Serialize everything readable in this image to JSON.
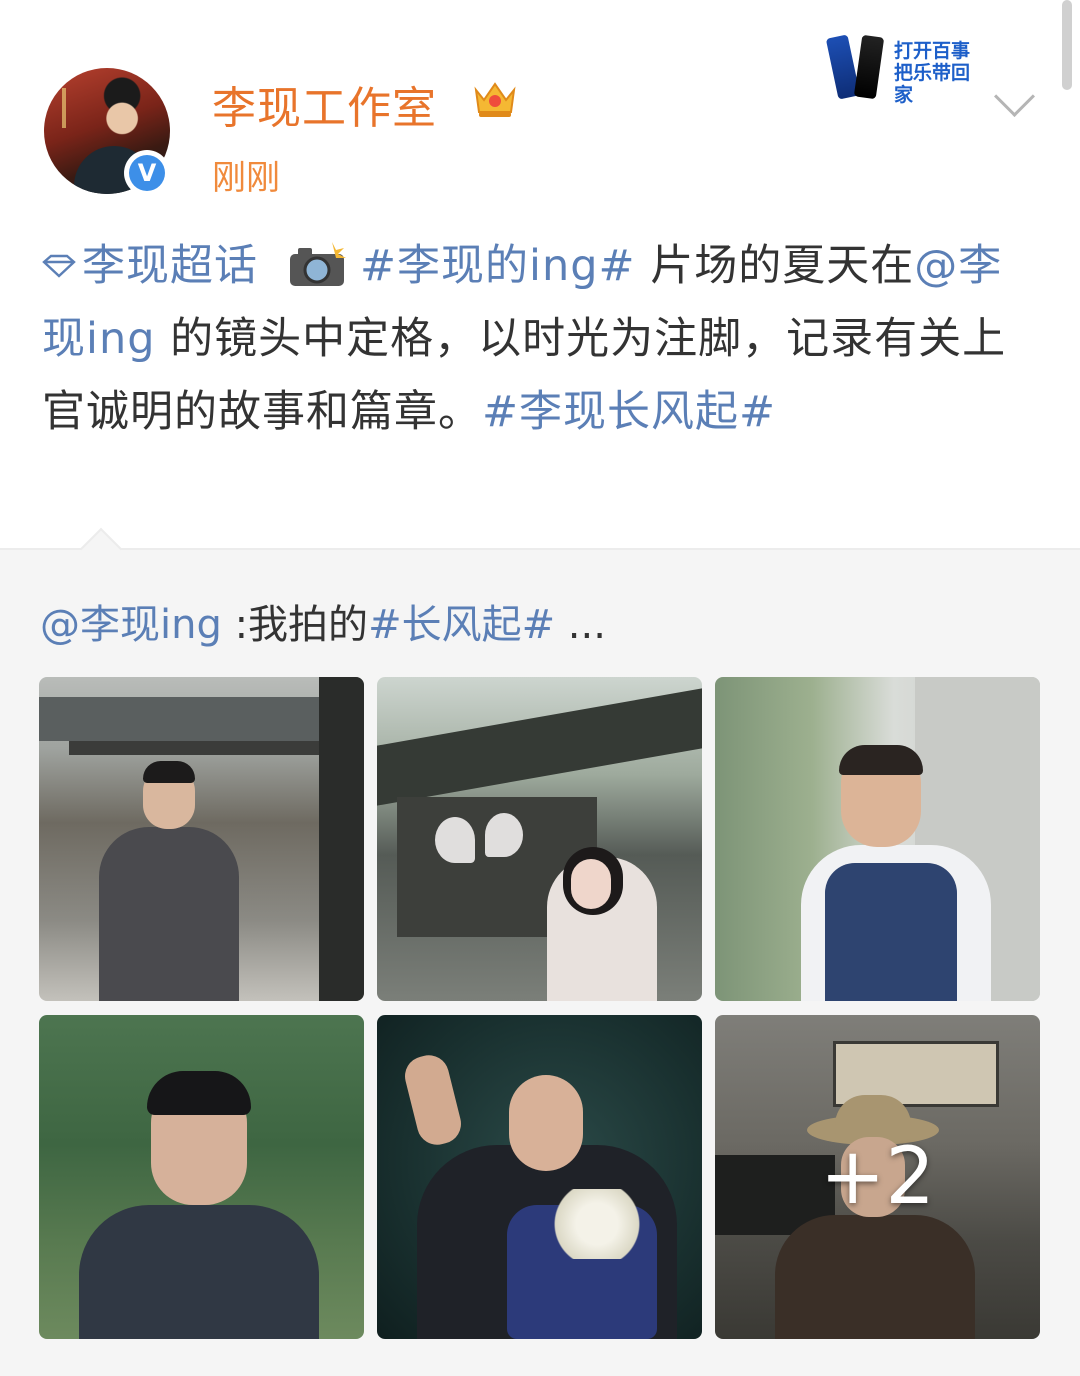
{
  "post": {
    "username": "李现工作室",
    "timestamp": "刚刚",
    "ad_text_line1": "打开百事",
    "ad_text_line2": "把乐带回家",
    "supertopic": "李现超话",
    "hashtag1": "#李现的ing#",
    "text1": " 片场的夏天在",
    "mention": "@李现ing",
    "text2": " 的镜头中定格，以时光为注脚，记录有关上官诚明的故事和篇章。",
    "hashtag2": "#李现长风起#"
  },
  "repost": {
    "mention": "@李现ing",
    "text": " :我拍的",
    "hashtag": "#长风起#",
    "ellipsis": " ..."
  },
  "gallery": {
    "more_label": "+2",
    "images": [
      {
        "name": "photo-man-in-suit-courtyard"
      },
      {
        "name": "photo-woman-with-butterfly"
      },
      {
        "name": "photo-man-in-vest-glasses"
      },
      {
        "name": "photo-man-in-changshan"
      },
      {
        "name": "photo-bald-man-with-flowers"
      },
      {
        "name": "photo-man-in-hat-peace-sign"
      }
    ]
  },
  "colors": {
    "username": "#e8742b",
    "link": "#5b7fb6",
    "verified": "#3d8fe8"
  }
}
